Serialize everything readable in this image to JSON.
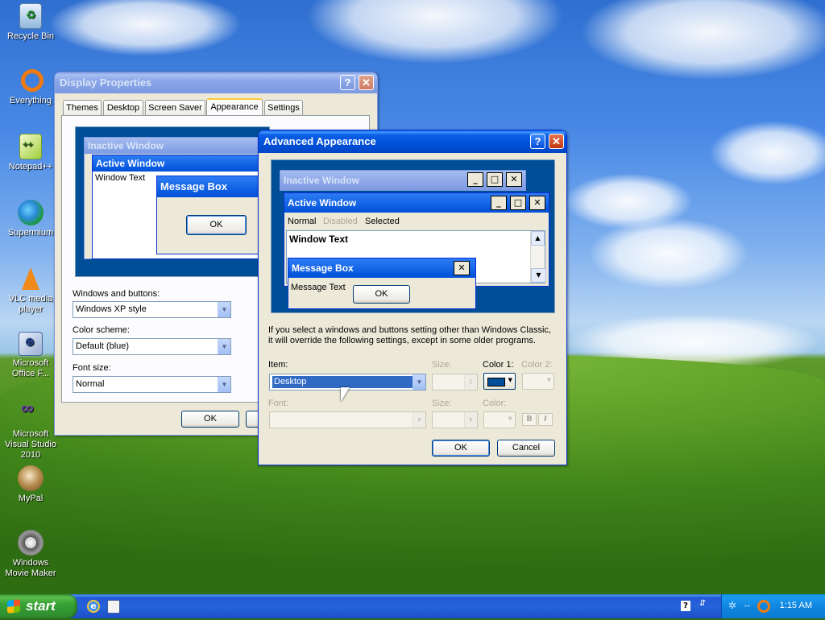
{
  "desktop": {
    "icons": [
      {
        "label": "Recycle Bin",
        "icon": "recycle-bin-icon"
      },
      {
        "label": "Everything",
        "icon": "everything-search-icon"
      },
      {
        "label": "Notepad++",
        "icon": "notepad-plus-plus-icon"
      },
      {
        "label": "Supermium",
        "icon": "supermium-browser-icon"
      },
      {
        "label": "VLC media player",
        "icon": "vlc-cone-icon"
      },
      {
        "label": "Microsoft Office F...",
        "icon": "office-frontpage-icon"
      },
      {
        "label": "Microsoft Visual Studio 2010",
        "icon": "visual-studio-icon"
      },
      {
        "label": "MyPal",
        "icon": "mypal-browser-icon"
      },
      {
        "label": "Windows Movie Maker",
        "icon": "movie-maker-icon"
      }
    ]
  },
  "display_properties": {
    "title": "Display Properties",
    "tabs": [
      "Themes",
      "Desktop",
      "Screen Saver",
      "Appearance",
      "Settings"
    ],
    "selected_tab": "Appearance",
    "preview": {
      "inactive_title": "Inactive Window",
      "active_title": "Active Window",
      "window_text": "Window Text",
      "message_box_title": "Message Box",
      "ok": "OK"
    },
    "windows_buttons_label": "Windows and buttons:",
    "windows_buttons_value": "Windows XP style",
    "color_scheme_label": "Color scheme:",
    "color_scheme_value": "Default (blue)",
    "font_size_label": "Font size:",
    "font_size_value": "Normal",
    "ok_button": "OK"
  },
  "advanced_appearance": {
    "title": "Advanced Appearance",
    "preview": {
      "inactive_title": "Inactive Window",
      "active_title": "Active Window",
      "menu_normal": "Normal",
      "menu_disabled": "Disabled",
      "menu_selected": "Selected",
      "window_text": "Window Text",
      "message_box_title": "Message Box",
      "message_text": "Message Text",
      "ok": "OK"
    },
    "info_text_line1": "If you select a windows and buttons setting other than Windows Classic,",
    "info_text_line2": "it will override the following settings, except in some older programs.",
    "item_label": "Item:",
    "item_value": "Desktop",
    "size_label": "Size:",
    "color1_label": "Color 1:",
    "color1_value": "#004e98",
    "color2_label": "Color 2:",
    "font_label": "Font:",
    "font_size_label": "Size:",
    "font_color_label": "Color:",
    "bold_label": "B",
    "italic_label": "I",
    "ok_button": "OK",
    "cancel_button": "Cancel"
  },
  "taskbar": {
    "start_label": "start",
    "clock": "1:15 AM"
  },
  "colors": {
    "titlebar_blue": "#0050d8",
    "preview_bg": "#004e98",
    "window_face": "#ece9d8",
    "start_green": "#37a236"
  }
}
